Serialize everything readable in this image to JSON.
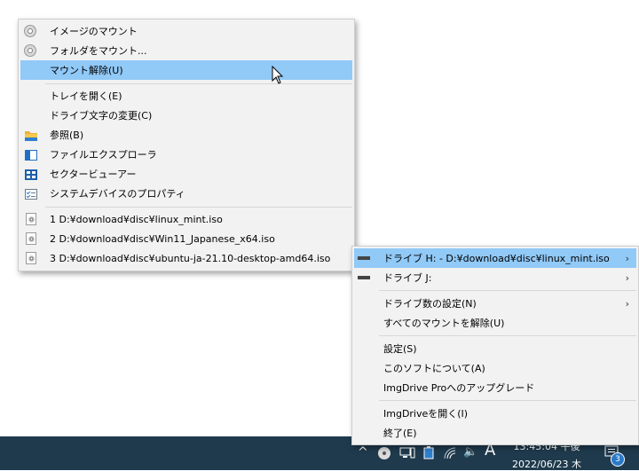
{
  "left_menu": {
    "items": [
      {
        "label": "イメージのマウント",
        "icon": "disc-icon"
      },
      {
        "label": "フォルダをマウント...",
        "icon": "disc-icon"
      },
      {
        "label": "マウント解除(U)",
        "icon": "",
        "highlighted": true
      },
      {
        "label": "トレイを開く(E)",
        "icon": ""
      },
      {
        "label": "ドライブ文字の変更(C)",
        "icon": ""
      },
      {
        "label": "参照(B)",
        "icon": "folder-icon"
      },
      {
        "label": "ファイルエクスプローラ",
        "icon": "explorer-icon"
      },
      {
        "label": "セクタービューアー",
        "icon": "sector-viewer-icon"
      },
      {
        "label": "システムデバイスのプロパティ",
        "icon": "properties-icon"
      },
      {
        "label": "1 D:¥download¥disc¥linux_mint.iso",
        "icon": "iso-file-icon"
      },
      {
        "label": "2 D:¥download¥disc¥Win11_Japanese_x64.iso",
        "icon": "iso-file-icon"
      },
      {
        "label": "3 D:¥download¥disc¥ubuntu-ja-21.10-desktop-amd64.iso",
        "icon": "iso-file-icon"
      }
    ]
  },
  "right_menu": {
    "items": [
      {
        "label": "ドライブ H: - D:¥download¥disc¥linux_mint.iso",
        "icon": "drive-icon",
        "highlighted": true,
        "submenu": true
      },
      {
        "label": "ドライブ J:",
        "icon": "drive-icon",
        "submenu": true
      },
      {
        "label": "ドライブ数の設定(N)",
        "submenu": true
      },
      {
        "label": "すべてのマウントを解除(U)"
      },
      {
        "label": "設定(S)"
      },
      {
        "label": "このソフトについて(A)"
      },
      {
        "label": "ImgDrive Proへのアップグレード"
      },
      {
        "label": "ImgDriveを開く(I)"
      },
      {
        "label": "終了(E)"
      }
    ]
  },
  "taskbar": {
    "time": "13:45:04 午後",
    "date": "2022/06/23 木",
    "ime": "A",
    "notification_count": "3",
    "colors": {
      "taskbar": "#1f3a4d",
      "highlight": "#91c9f7"
    }
  }
}
